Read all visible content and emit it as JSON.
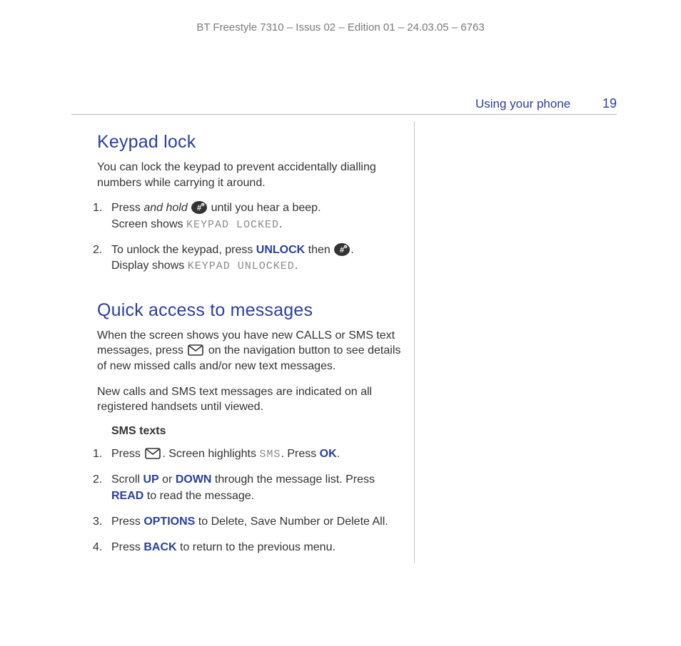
{
  "meta": {
    "doc_line": "BT Freestyle 7310 – Issus 02 – Edition 01 – 24.03.05 – 6763"
  },
  "running_head": {
    "section": "Using your phone",
    "page_number": "19"
  },
  "section1": {
    "title": "Keypad lock",
    "intro": "You can lock the keypad to prevent accidentally dialling numbers while carrying it around.",
    "step1_a": "Press ",
    "step1_b_italic": "and hold",
    "step1_c": " ",
    "step1_d": " until you hear a beep.",
    "step1_line2a": "Screen shows ",
    "step1_screen": "KEYPAD LOCKED",
    "step1_line2b": ".",
    "step2_a": "To unlock the keypad, press ",
    "step2_key": "UNLOCK",
    "step2_b": " then ",
    "step2_c": ".",
    "step2_line2a": "Display shows ",
    "step2_screen": "KEYPAD UNLOCKED",
    "step2_line2b": "."
  },
  "section2": {
    "title": "Quick access to messages",
    "intro_a": "When the screen shows you have new CALLS or SMS text messages, press ",
    "intro_b": " on the navigation button to see details of new missed calls and/or new text messages.",
    "note": "New calls and SMS text messages are indicated on all registered handsets until viewed.",
    "sub_sms": {
      "heading": "SMS texts",
      "s1_a": "Press ",
      "s1_b": ". Screen highlights ",
      "s1_screen": "SMS",
      "s1_c": ". Press ",
      "s1_key": "OK",
      "s1_d": ".",
      "s2_a": "Scroll ",
      "s2_up": "UP",
      "s2_b": " or ",
      "s2_down": "DOWN",
      "s2_c": " through the message list. Press ",
      "s2_read": "READ",
      "s2_d": " to read the message.",
      "s3_a": "Press ",
      "s3_key": "OPTIONS",
      "s3_b": " to Delete, Save Number or Delete All.",
      "s4_a": "Press ",
      "s4_key": "BACK",
      "s4_b": " to return to the previous menu."
    }
  }
}
